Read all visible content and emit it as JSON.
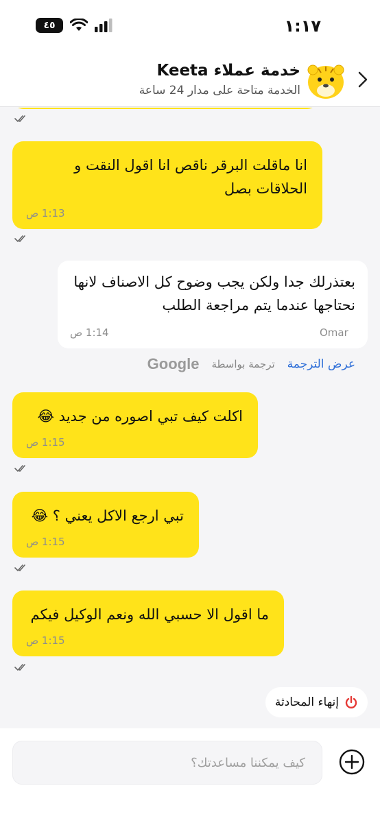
{
  "status": {
    "time": "١:١٧",
    "battery": "٤٥"
  },
  "header": {
    "title": "خدمة عملاء Keeta",
    "subtitle": "الخدمة متاحة على مدار 24 ساعة"
  },
  "messages": [
    {
      "text": "انا ماقلت البرقر ناقص انا اقول النقت و الحلاقات بصل",
      "time": "1:13 ص"
    },
    {
      "text": "بعتذرلك جدا ولكن يجب وضوح كل الاصناف لانها نحتاجها عندما يتم مراجعة الطلب",
      "time": "1:14 ص",
      "sender": "Omar"
    },
    {
      "text": "اكلت كيف تبي اصوره من جديد 😂",
      "time": "1:15 ص"
    },
    {
      "text": "تبي ارجع الاكل يعني ؟ 😂",
      "time": "1:15 ص"
    },
    {
      "text": "ما اقول الا حسبي الله ونعم الوكيل فيكم",
      "time": "1:15 ص"
    }
  ],
  "translation": {
    "show_label": "عرض الترجمة",
    "by_label": "ترجمة بواسطة",
    "provider": "Google"
  },
  "end_chat": {
    "label": "إنهاء المحادثة"
  },
  "composer": {
    "placeholder": "كيف يمكننا مساعدتك؟"
  },
  "colors": {
    "brand_yellow": "#ffe31a",
    "link_blue": "#2f6fd8",
    "end_red": "#e53935"
  }
}
